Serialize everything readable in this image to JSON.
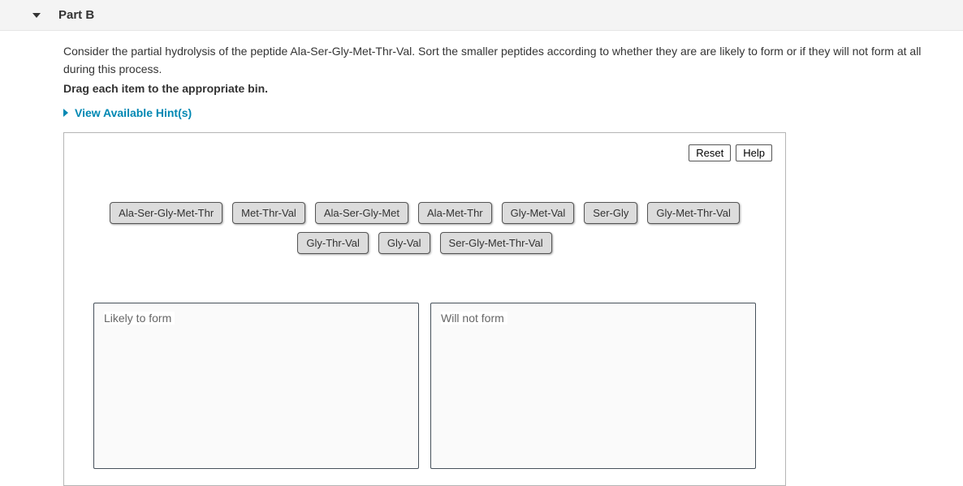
{
  "header": {
    "title": "Part B"
  },
  "question": {
    "prompt": "Consider the partial hydrolysis of the peptide Ala-Ser-Gly-Met-Thr-Val. Sort the smaller peptides according to whether they are are likely to form or if they will not form at all during this process.",
    "instruction": "Drag each item to the appropriate bin."
  },
  "hints": {
    "label": "View Available Hint(s)"
  },
  "buttons": {
    "reset": "Reset",
    "help": "Help"
  },
  "chips": [
    "Ala-Ser-Gly-Met-Thr",
    "Met-Thr-Val",
    "Ala-Ser-Gly-Met",
    "Ala-Met-Thr",
    "Gly-Met-Val",
    "Ser-Gly",
    "Gly-Met-Thr-Val",
    "Gly-Thr-Val",
    "Gly-Val",
    "Ser-Gly-Met-Thr-Val"
  ],
  "bins": {
    "left": "Likely to form",
    "right": "Will not form"
  }
}
